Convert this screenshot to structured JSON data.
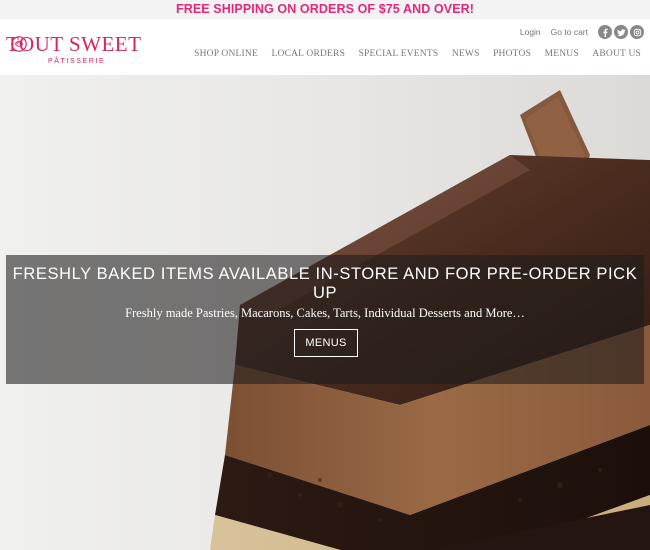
{
  "promo": {
    "text": "FREE SHIPPING ON ORDERS OF $75 AND OVER!"
  },
  "brand": {
    "name": "TOUT SWEET",
    "tagline": "PÂTISSERIE"
  },
  "utility": {
    "login": "Login",
    "cart": "Go to cart"
  },
  "social": [
    "facebook-icon",
    "twitter-icon",
    "instagram-icon"
  ],
  "nav": [
    "SHOP ONLINE",
    "LOCAL ORDERS",
    "SPECIAL EVENTS",
    "NEWS",
    "PHOTOS",
    "MENUS",
    "ABOUT US"
  ],
  "hero": {
    "title": "FRESHLY BAKED ITEMS AVAILABLE IN-STORE AND FOR PRE-ORDER PICK UP",
    "subtitle": "Freshly made Pastries, Macarons, Cakes, Tarts, Individual Desserts and More…",
    "button": "MENUS"
  },
  "colors": {
    "brand_pink": "#d9245f",
    "promo_pink": "#e0297a",
    "nav_gray": "#777777"
  }
}
